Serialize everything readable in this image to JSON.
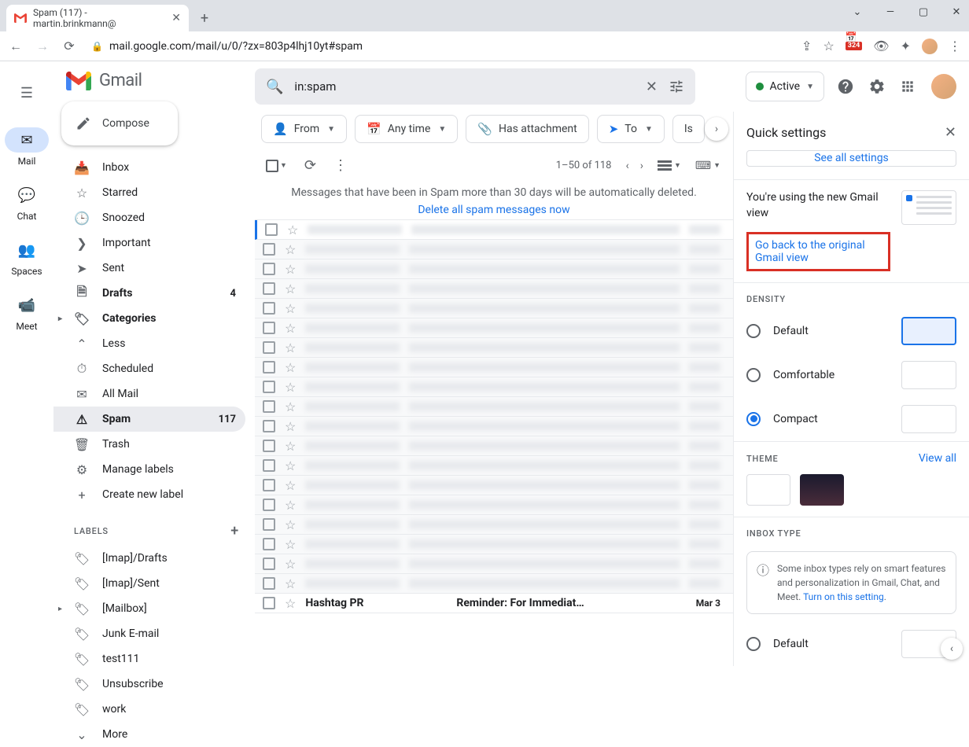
{
  "browser": {
    "tab_title": "Spam (117) - martin.brinkmann@",
    "url": "mail.google.com/mail/u/0/?zx=803p4lhj10yt#spam",
    "ext_badge": "324"
  },
  "rail": {
    "items": [
      {
        "label": "Mail",
        "active": true
      },
      {
        "label": "Chat",
        "active": false
      },
      {
        "label": "Spaces",
        "active": false
      },
      {
        "label": "Meet",
        "active": false
      }
    ]
  },
  "logo_text": "Gmail",
  "compose_label": "Compose",
  "folders": [
    {
      "name": "Inbox",
      "icon": "inbox",
      "bold": false
    },
    {
      "name": "Starred",
      "icon": "star",
      "bold": false
    },
    {
      "name": "Snoozed",
      "icon": "clock",
      "bold": false
    },
    {
      "name": "Important",
      "icon": "important",
      "bold": false
    },
    {
      "name": "Sent",
      "icon": "sent",
      "bold": false
    },
    {
      "name": "Drafts",
      "icon": "draft",
      "bold": true,
      "count": "4"
    },
    {
      "name": "Categories",
      "icon": "label",
      "bold": true,
      "caret": true
    },
    {
      "name": "Less",
      "icon": "chev-up",
      "bold": false
    },
    {
      "name": "Scheduled",
      "icon": "scheduled",
      "bold": false
    },
    {
      "name": "All Mail",
      "icon": "allmail",
      "bold": false
    },
    {
      "name": "Spam",
      "icon": "spam",
      "bold": true,
      "count": "117",
      "active": true
    },
    {
      "name": "Trash",
      "icon": "trash",
      "bold": false
    },
    {
      "name": "Manage labels",
      "icon": "gear",
      "bold": false
    },
    {
      "name": "Create new label",
      "icon": "plus",
      "bold": false
    }
  ],
  "labels_header": "LABELS",
  "labels": [
    {
      "name": "[Imap]/Drafts"
    },
    {
      "name": "[Imap]/Sent"
    },
    {
      "name": "[Mailbox]",
      "caret": true
    },
    {
      "name": "Junk E-mail"
    },
    {
      "name": "test111"
    },
    {
      "name": "Unsubscribe"
    },
    {
      "name": "work"
    },
    {
      "name": "More",
      "icon": "chev-down"
    }
  ],
  "search": {
    "value": "in:spam"
  },
  "active_chip": "Active",
  "filter_chips": [
    {
      "label": "From",
      "icon": "person",
      "chev": true
    },
    {
      "label": "Any time",
      "icon": "calendar",
      "chev": true
    },
    {
      "label": "Has attachment",
      "icon": "attach",
      "chev": false
    },
    {
      "label": "To",
      "icon": "send",
      "chev": true
    },
    {
      "label": "Is",
      "icon": "",
      "chev": false
    }
  ],
  "pagination": "1–50 of 118",
  "banner": {
    "text": "Messages that have been in Spam more than 30 days will be automatically deleted.",
    "link": "Delete all spam messages now"
  },
  "messages": {
    "blurred_count": 19,
    "visible": {
      "sender": "Hashtag PR",
      "subject": "Reminder: For Immediat…",
      "date": "Mar 3"
    }
  },
  "qs": {
    "title": "Quick settings",
    "see_all": "See all settings",
    "new_view_text": "You're using the new Gmail view",
    "go_back": "Go back to the original Gmail view",
    "density_label": "DENSITY",
    "density_opts": [
      "Default",
      "Comfortable",
      "Compact"
    ],
    "density_selected": "Compact",
    "theme_label": "THEME",
    "view_all": "View all",
    "inbox_label": "INBOX TYPE",
    "inbox_note": "Some inbox types rely on smart features and personalization in Gmail, Chat, and Meet. ",
    "inbox_link": "Turn on this setting",
    "inbox_default": "Default"
  }
}
